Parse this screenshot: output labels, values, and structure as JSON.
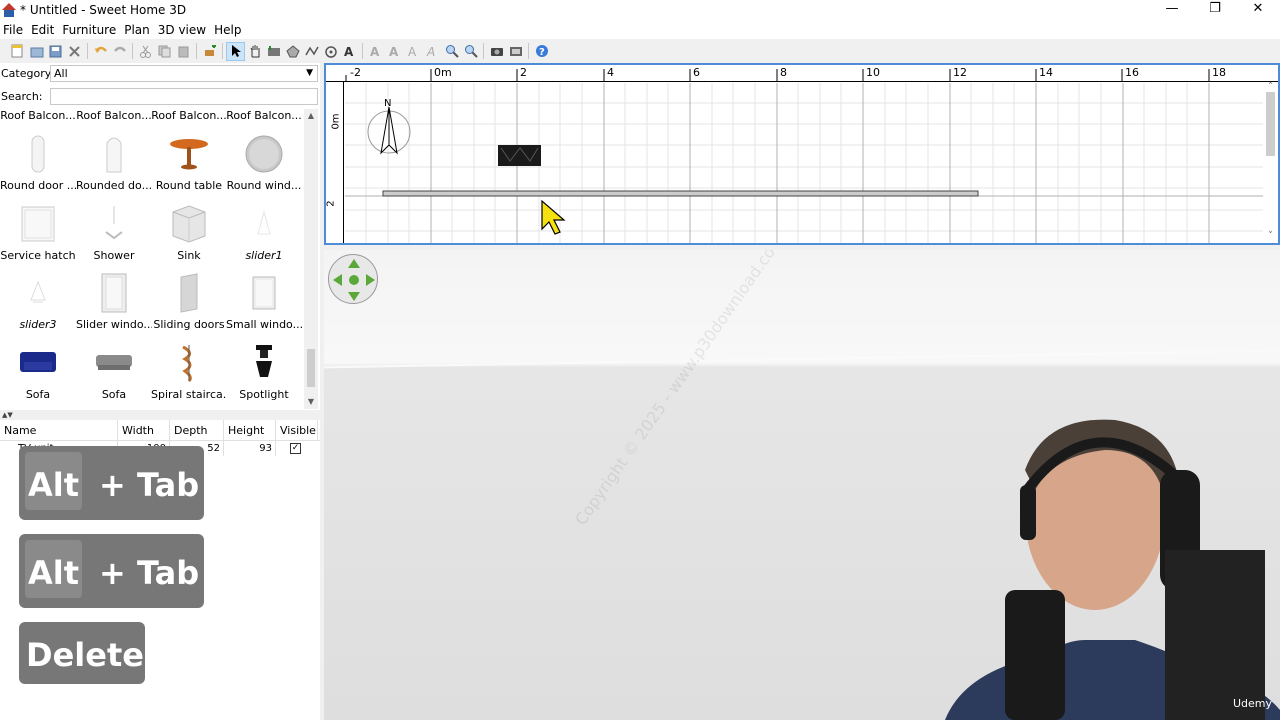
{
  "window": {
    "title": "* Untitled - Sweet Home 3D",
    "minimize": "—",
    "maximize": "❐",
    "close": "✕"
  },
  "menu": [
    "File",
    "Edit",
    "Furniture",
    "Plan",
    "3D view",
    "Help"
  ],
  "catalog": {
    "category_label": "Category:",
    "category_value": "All",
    "search_label": "Search:",
    "search_value": "",
    "top_row": [
      "Roof Balcon...",
      "Roof Balcon...",
      "Roof Balcon...",
      "Roof Balcon..."
    ],
    "items": [
      {
        "label": "Round door ...",
        "italic": false
      },
      {
        "label": "Rounded do...",
        "italic": false
      },
      {
        "label": "Round table",
        "italic": false
      },
      {
        "label": "Round wind...",
        "italic": false
      },
      {
        "label": "Service hatch",
        "italic": false
      },
      {
        "label": "Shower",
        "italic": false
      },
      {
        "label": "Sink",
        "italic": false
      },
      {
        "label": "slider1",
        "italic": true
      },
      {
        "label": "slider3",
        "italic": true
      },
      {
        "label": "Slider windo...",
        "italic": false
      },
      {
        "label": "Sliding doors",
        "italic": false
      },
      {
        "label": "Small windo...",
        "italic": false
      },
      {
        "label": "Sofa",
        "italic": false
      },
      {
        "label": "Sofa",
        "italic": false
      },
      {
        "label": "Spiral stairca...",
        "italic": false
      },
      {
        "label": "Spotlight",
        "italic": false
      }
    ]
  },
  "furniture_table": {
    "headers": [
      "Name",
      "Width",
      "Depth",
      "Height",
      "Visible"
    ],
    "row": {
      "name": "TV unit",
      "width": "100",
      "depth": "52",
      "height": "93",
      "visible": true
    }
  },
  "key_overlays": {
    "alt": "Alt",
    "plus_tab": "+ Tab",
    "delete": "Delete"
  },
  "plan": {
    "ruler_top": [
      "-2",
      "0m",
      "2",
      "4",
      "6",
      "8",
      "10",
      "12",
      "14",
      "16",
      "18"
    ],
    "ruler_left": [
      "0m",
      "2"
    ],
    "compass_label": "N"
  },
  "view3d": {
    "watermark": "Copyright © 2025 - www.p30download.com"
  },
  "webcam": {
    "brand": "Udemy"
  },
  "colors": {
    "selection_border": "#4e8cd8",
    "keycap": "#777777",
    "sofa_blue": "#1a2a8a",
    "table_orange": "#d2691e"
  }
}
